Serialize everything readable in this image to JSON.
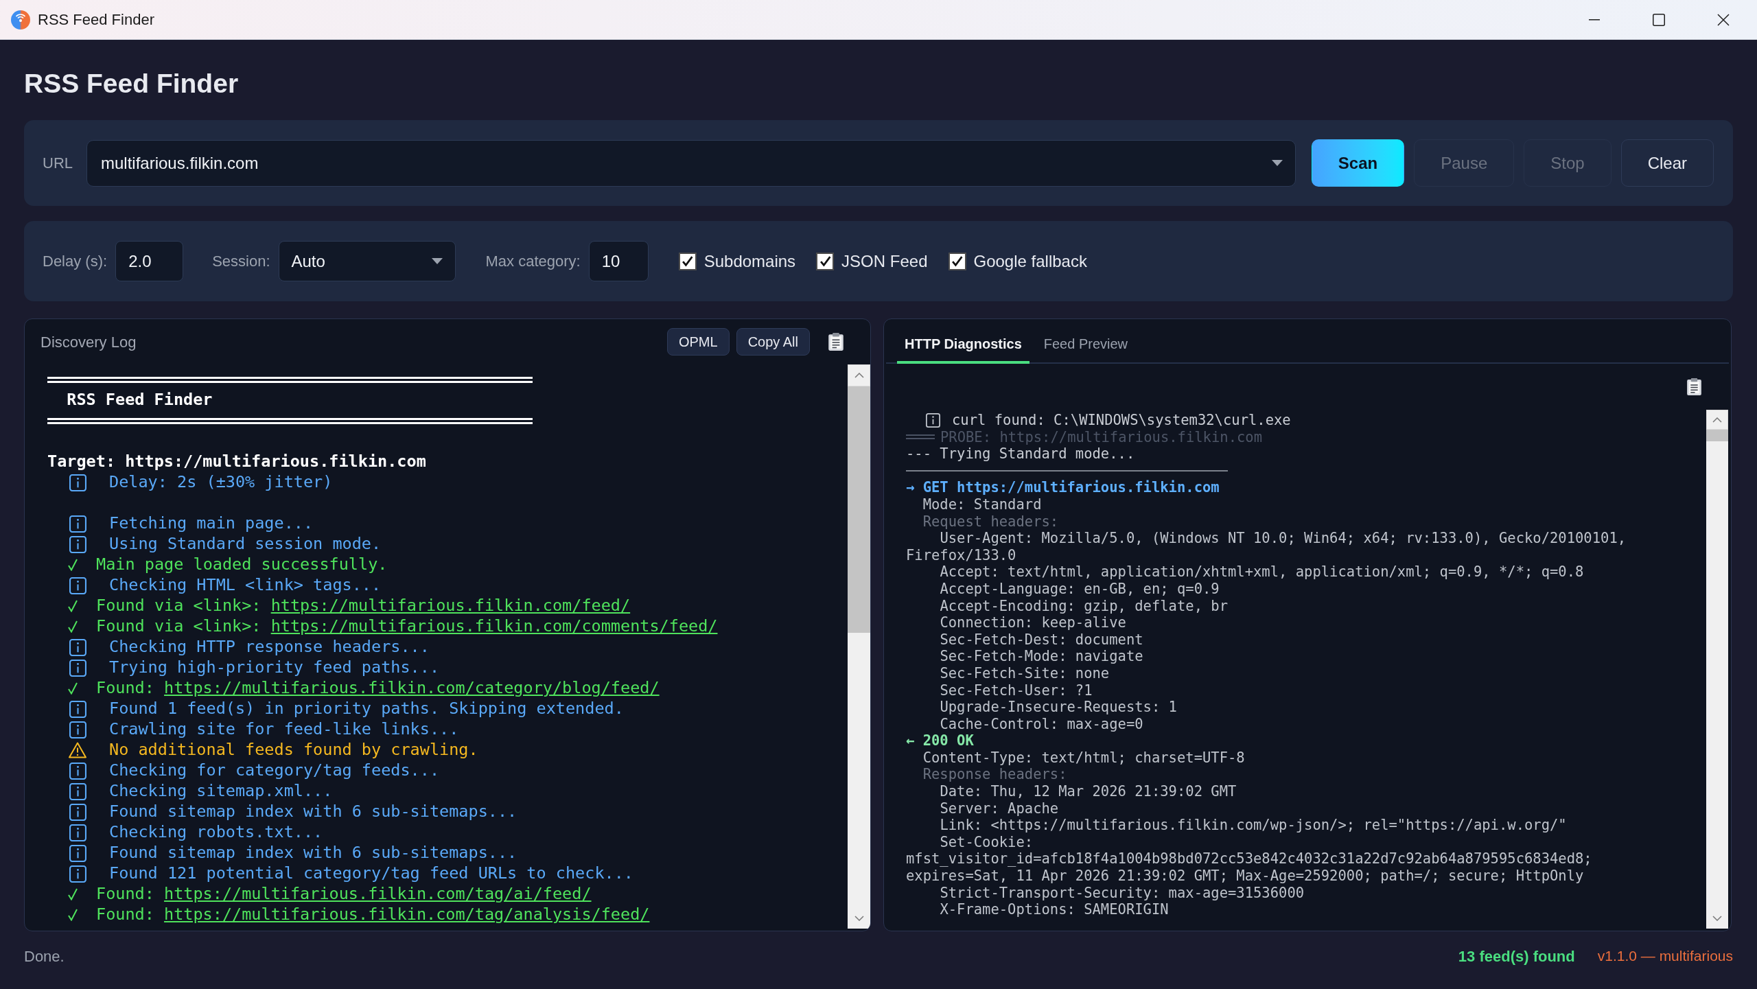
{
  "window": {
    "title": "RSS Feed Finder"
  },
  "app_title": "RSS Feed Finder",
  "url_bar": {
    "label": "URL",
    "value": "multifarious.filkin.com"
  },
  "buttons": [
    {
      "label": "Scan",
      "kind": "primary",
      "disabled": false
    },
    {
      "label": "Pause",
      "kind": "secondary",
      "disabled": true
    },
    {
      "label": "Stop",
      "kind": "secondary",
      "disabled": true
    },
    {
      "label": "Clear",
      "kind": "secondary",
      "disabled": false
    }
  ],
  "options": {
    "delay": {
      "label": "Delay (s):",
      "value": "2.0"
    },
    "session": {
      "label": "Session:",
      "value": "Auto"
    },
    "max_category": {
      "label": "Max category:",
      "value": "10"
    },
    "checkboxes": [
      {
        "label": "Subdomains",
        "checked": true
      },
      {
        "label": "JSON Feed",
        "checked": true
      },
      {
        "label": "Google fallback",
        "checked": true
      }
    ]
  },
  "discovery_log": {
    "title": "Discovery Log",
    "buttons": [
      "OPML",
      "Copy All"
    ],
    "lines": [
      {
        "kind": "rule"
      },
      {
        "kind": "title",
        "text": "RSS Feed Finder"
      },
      {
        "kind": "rule"
      },
      {
        "kind": "blank"
      },
      {
        "kind": "target",
        "text": "Target: https://multifarious.filkin.com"
      },
      {
        "kind": "info",
        "text": "Delay: 2s (±30% jitter)"
      },
      {
        "kind": "blank"
      },
      {
        "kind": "info",
        "text": "Fetching main page..."
      },
      {
        "kind": "info",
        "text": "Using Standard session mode."
      },
      {
        "kind": "success",
        "text": "Main page loaded successfully."
      },
      {
        "kind": "info",
        "text": "Checking HTML <link> tags..."
      },
      {
        "kind": "success",
        "text": "Found via <link>:",
        "link": "https://multifarious.filkin.com/feed/"
      },
      {
        "kind": "success",
        "text": "Found via <link>:",
        "link": "https://multifarious.filkin.com/comments/feed/"
      },
      {
        "kind": "info",
        "text": "Checking HTTP response headers..."
      },
      {
        "kind": "info",
        "text": "Trying high-priority feed paths..."
      },
      {
        "kind": "success",
        "text": "Found:",
        "link": "https://multifarious.filkin.com/category/blog/feed/"
      },
      {
        "kind": "info",
        "text": "Found 1 feed(s) in priority paths. Skipping extended."
      },
      {
        "kind": "info",
        "text": "Crawling site for feed-like links..."
      },
      {
        "kind": "warning",
        "text": "No additional feeds found by crawling."
      },
      {
        "kind": "info",
        "text": "Checking for category/tag feeds..."
      },
      {
        "kind": "info",
        "text": "Checking sitemap.xml..."
      },
      {
        "kind": "info",
        "text": "Found sitemap index with 6 sub-sitemaps..."
      },
      {
        "kind": "info",
        "text": "Checking robots.txt..."
      },
      {
        "kind": "info",
        "text": "Found sitemap index with 6 sub-sitemaps..."
      },
      {
        "kind": "info",
        "text": "Found 121 potential category/tag feed URLs to check..."
      },
      {
        "kind": "success",
        "text": "Found:",
        "link": "https://multifarious.filkin.com/tag/ai/feed/"
      },
      {
        "kind": "success",
        "text": "Found:",
        "link": "https://multifarious.filkin.com/tag/analysis/feed/"
      }
    ]
  },
  "diagnostics": {
    "tabs": [
      {
        "label": "HTTP Diagnostics",
        "selected": true
      },
      {
        "label": "Feed Preview",
        "selected": false
      }
    ],
    "lines": [
      {
        "kind": "info",
        "text": "curl found: C:\\WINDOWS\\system32\\curl.exe"
      },
      {
        "kind": "probe",
        "text": "PROBE: https://multifarious.filkin.com"
      },
      {
        "kind": "plain",
        "text": "--- Trying Standard mode..."
      },
      {
        "kind": "rule"
      },
      {
        "kind": "request",
        "text": "→ GET https://multifarious.filkin.com"
      },
      {
        "kind": "detail",
        "text": "  Mode: Standard"
      },
      {
        "kind": "section",
        "text": "  Request headers:"
      },
      {
        "kind": "detail",
        "text": "    User-Agent: Mozilla/5.0, (Windows NT 10.0; Win64; x64; rv:133.0), Gecko/20100101, Firefox/133.0"
      },
      {
        "kind": "detail",
        "text": "    Accept: text/html, application/xhtml+xml, application/xml; q=0.9, */*; q=0.8"
      },
      {
        "kind": "detail",
        "text": "    Accept-Language: en-GB, en; q=0.9"
      },
      {
        "kind": "detail",
        "text": "    Accept-Encoding: gzip, deflate, br"
      },
      {
        "kind": "detail",
        "text": "    Connection: keep-alive"
      },
      {
        "kind": "detail",
        "text": "    Sec-Fetch-Dest: document"
      },
      {
        "kind": "detail",
        "text": "    Sec-Fetch-Mode: navigate"
      },
      {
        "kind": "detail",
        "text": "    Sec-Fetch-Site: none"
      },
      {
        "kind": "detail",
        "text": "    Sec-Fetch-User: ?1"
      },
      {
        "kind": "detail",
        "text": "    Upgrade-Insecure-Requests: 1"
      },
      {
        "kind": "detail",
        "text": "    Cache-Control: max-age=0"
      },
      {
        "kind": "response",
        "text": "← 200 OK"
      },
      {
        "kind": "detail",
        "text": "  Content-Type: text/html; charset=UTF-8"
      },
      {
        "kind": "section",
        "text": "  Response headers:"
      },
      {
        "kind": "detail",
        "text": "    Date: Thu, 12 Mar 2026 21:39:02 GMT"
      },
      {
        "kind": "detail",
        "text": "    Server: Apache"
      },
      {
        "kind": "detail",
        "text": "    Link: <https://multifarious.filkin.com/wp-json/>; rel=\"https://api.w.org/\""
      },
      {
        "kind": "detail",
        "text": "    Set-Cookie: mfst_visitor_id=afcb18f4a1004b98bd072cc53e842c4032c31a22d7c92ab64a879595c6834ed8; expires=Sat, 11 Apr 2026 21:39:02 GMT; Max-Age=2592000; path=/; secure; HttpOnly"
      },
      {
        "kind": "detail",
        "text": "    Strict-Transport-Security: max-age=31536000"
      },
      {
        "kind": "detail",
        "text": "    X-Frame-Options: SAMEORIGIN"
      }
    ]
  },
  "status_bar": {
    "message": "Done.",
    "feed_count": "13 feed(s) found",
    "version": "v1.1.0 — multifarious"
  }
}
